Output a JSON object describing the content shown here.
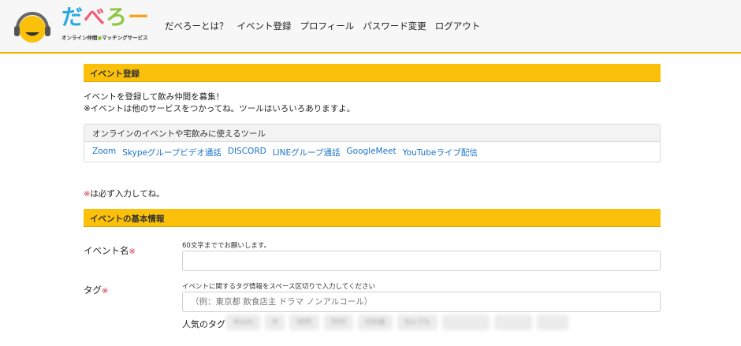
{
  "header": {
    "logo": {
      "main": "だべろー",
      "sub_left": "オンライン仲間",
      "sub_right": "マッチングサービス"
    },
    "nav": [
      "だべろーとは？",
      "イベント登録",
      "プロフィール",
      "パスワード変更",
      "ログアウト"
    ]
  },
  "section_event": {
    "title": "イベント登録",
    "intro_line1": "イベントを登録して飲み仲間を募集！",
    "intro_line2": "※イベントは他のサービスをつかってね。ツールはいろいろありますよ。"
  },
  "tools_card": {
    "title": "オンラインのイベントや宅飲みに使えるツール",
    "links": [
      "Zoom",
      "Skypeグループビデオ通話",
      "DISCORD",
      "LINEグループ通話",
      "GoogleMeet",
      "YouTubeライブ配信"
    ]
  },
  "required_note": {
    "mark": "※",
    "text": "は必ず入力してね。"
  },
  "section_basic": {
    "title": "イベントの基本情報"
  },
  "form": {
    "event_name": {
      "label": "イベント名",
      "mark": "※",
      "hint": "60文字まででお願いします。",
      "value": "",
      "placeholder": ""
    },
    "tag": {
      "label": "タグ",
      "mark": "※",
      "hint": "イベントに関するタグ情報をスペース区切りで入力してください",
      "value": "",
      "placeholder": "（例：東京都 飲食店主 ドラマ ノンアルコール）"
    },
    "popular_tags_label": "人気のタグ",
    "popular_tags": [
      "#sum",
      "#",
      "40代",
      "50代",
      "の計画",
      "なんでも",
      "",
      "",
      ""
    ]
  },
  "colors": {
    "accent": "#fbc10a",
    "link": "#1a73c8",
    "required": "#d6334a"
  }
}
